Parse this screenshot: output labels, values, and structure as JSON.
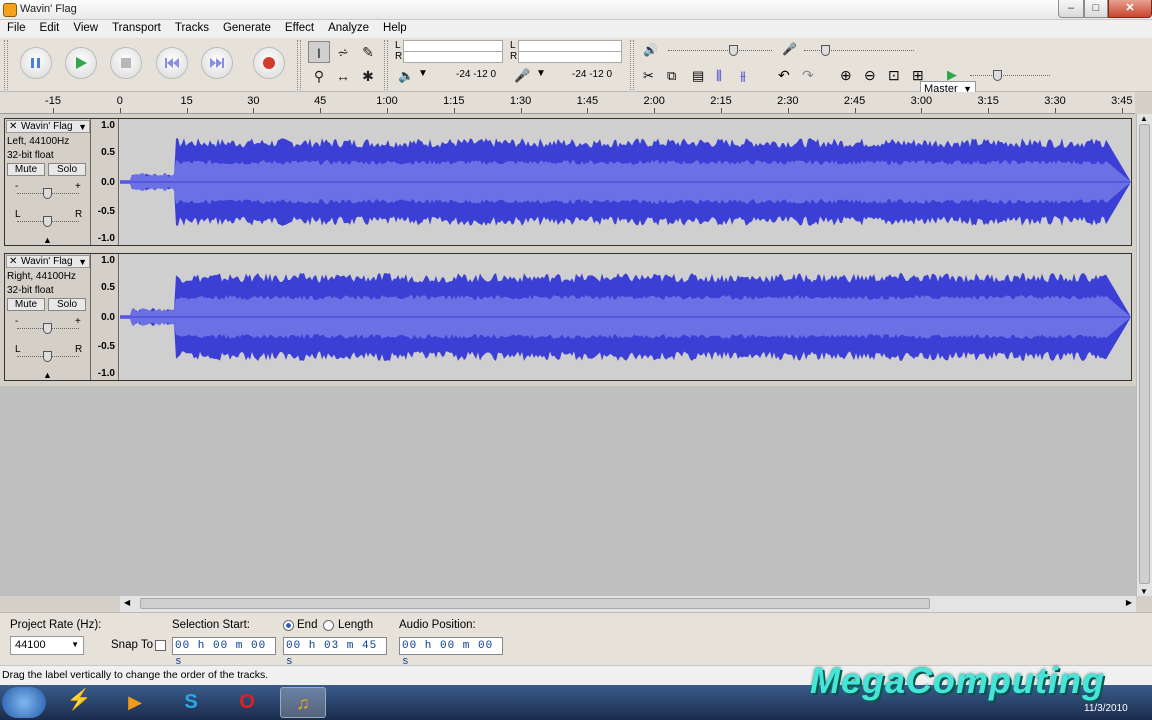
{
  "window": {
    "title": "Wavin' Flag"
  },
  "menu": [
    "File",
    "Edit",
    "View",
    "Transport",
    "Tracks",
    "Generate",
    "Effect",
    "Analyze",
    "Help"
  ],
  "meters": {
    "left_label": "L",
    "right_label": "R",
    "scale_a": "-24 -12  0",
    "scale_b": "-24 -12  0"
  },
  "mixer": {
    "device": "Master"
  },
  "ruler": {
    "ticks": [
      "-15",
      "0",
      "15",
      "30",
      "45",
      "1:00",
      "1:15",
      "1:30",
      "1:45",
      "2:00",
      "2:15",
      "2:30",
      "2:45",
      "3:00",
      "3:15",
      "3:30",
      "3:45"
    ]
  },
  "tracks": [
    {
      "name": "Wavin' Flag",
      "channel": "Left, 44100Hz",
      "format": "32-bit float",
      "mute": "Mute",
      "solo": "Solo",
      "gain_l": "-",
      "gain_r": "+",
      "pan_l": "L",
      "pan_r": "R",
      "scale": [
        "1.0",
        "0.5",
        "0.0",
        "-0.5",
        "-1.0"
      ]
    },
    {
      "name": "Wavin' Flag",
      "channel": "Right, 44100Hz",
      "format": "32-bit float",
      "mute": "Mute",
      "solo": "Solo",
      "gain_l": "-",
      "gain_r": "+",
      "pan_l": "L",
      "pan_r": "R",
      "scale": [
        "1.0",
        "0.5",
        "0.0",
        "-0.5",
        "-1.0"
      ]
    }
  ],
  "selection": {
    "project_rate_label": "Project Rate (Hz):",
    "project_rate": "44100",
    "snap_to": "Snap To",
    "selection_start_label": "Selection Start:",
    "end_label": "End",
    "length_label": "Length",
    "audio_position_label": "Audio Position:",
    "start_value": "00 h 00 m 00 s",
    "end_value": "00 h 03 m 45 s",
    "position_value": "00 h 00 m 00 s"
  },
  "status": "Drag the label vertically to change the order of the tracks.",
  "taskbar": {
    "date": "11/3/2010"
  },
  "watermark": "MegaComputing",
  "colors": {
    "wave": "#3b3fd6",
    "wave_light": "#6b70e4",
    "accent": "#f2a21b"
  }
}
